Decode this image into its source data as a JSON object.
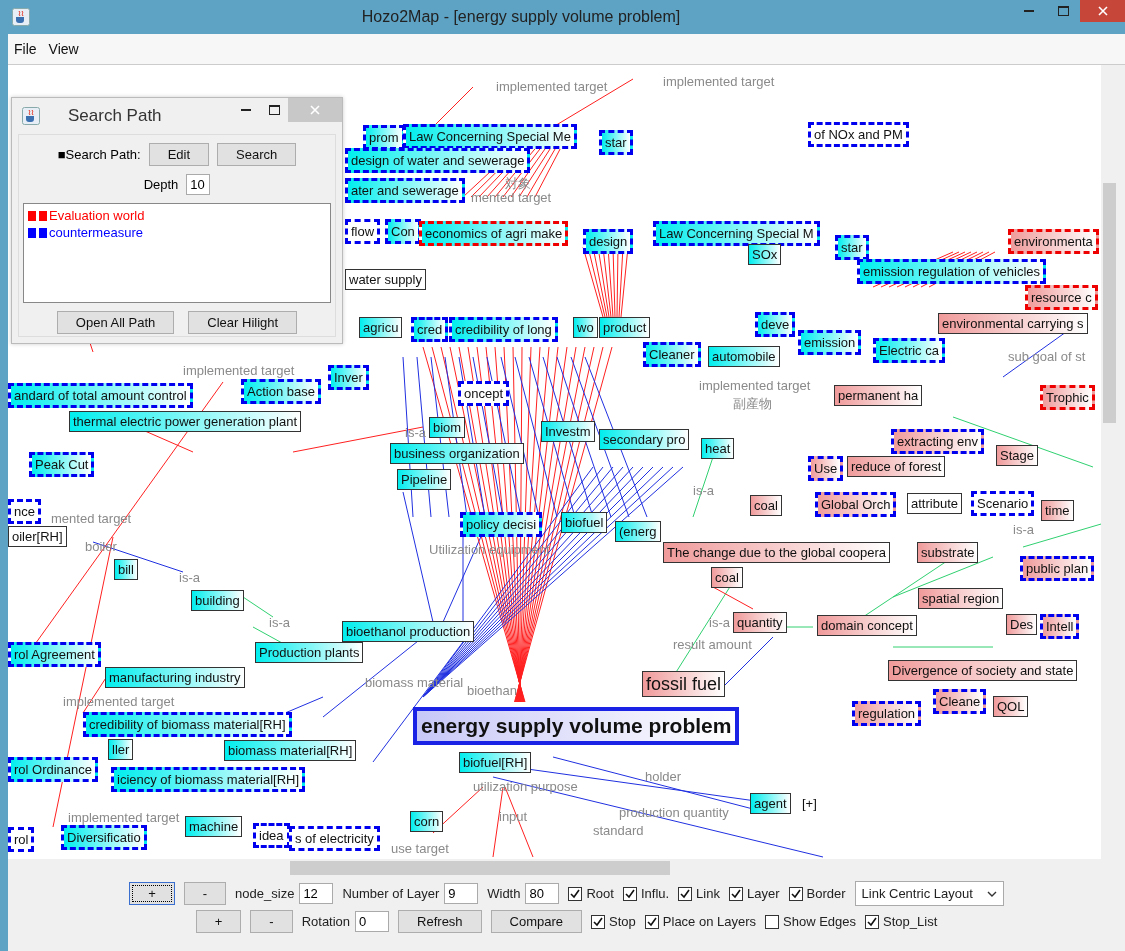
{
  "window": {
    "title": "Hozo2Map - [energy supply volume problem]"
  },
  "menu": [
    "File",
    "View"
  ],
  "graph": {
    "nodes": [
      {
        "text": "prom",
        "kind": "countermeasure",
        "color": "#0000ee"
      },
      {
        "text": "Law Concerning Special Me",
        "kind": "countermeasure",
        "color": "#0000ee"
      },
      {
        "text": "star",
        "kind": "countermeasure",
        "color": "#0000ee"
      },
      {
        "text": "of NOx and PM",
        "kind": "plain",
        "color": "#0000ee"
      },
      {
        "text": "design of water and sewerage",
        "kind": "countermeasure",
        "color": "#0000ee"
      },
      {
        "text": "ater and sewerage",
        "kind": "countermeasure",
        "color": "#0000ee"
      },
      {
        "text": "flow",
        "kind": "plain",
        "color": "#0000ee"
      },
      {
        "text": "Con",
        "kind": "countermeasure",
        "color": "#0000ee"
      },
      {
        "text": "economics of agri make",
        "kind": "countermeasure",
        "color": "#ee0000"
      },
      {
        "text": "design",
        "kind": "countermeasure",
        "color": "#0000ee"
      },
      {
        "text": "Law Concerning Special M",
        "kind": "countermeasure",
        "color": "#0000ee"
      },
      {
        "text": "star",
        "kind": "countermeasure",
        "color": "#0000ee"
      },
      {
        "text": "environmenta",
        "kind": "evaluation",
        "color": "#ee0000"
      },
      {
        "text": "SOx",
        "kind": "countermeasure"
      },
      {
        "text": "water supply",
        "kind": "plain"
      },
      {
        "text": "emission regulation of vehicles",
        "kind": "countermeasure",
        "color": "#0000ee"
      },
      {
        "text": "resource c",
        "kind": "evaluation",
        "color": "#ee0000"
      },
      {
        "text": "agricu",
        "kind": "countermeasure"
      },
      {
        "text": "cred",
        "kind": "countermeasure",
        "color": "#0000ee"
      },
      {
        "text": "credibility of long",
        "kind": "countermeasure",
        "color": "#0000ee"
      },
      {
        "text": "wo",
        "kind": "countermeasure"
      },
      {
        "text": "product",
        "kind": "countermeasure"
      },
      {
        "text": "deve",
        "kind": "countermeasure",
        "color": "#0000ee"
      },
      {
        "text": "Cleaner",
        "kind": "countermeasure",
        "color": "#0000ee"
      },
      {
        "text": "automobile",
        "kind": "countermeasure"
      },
      {
        "text": "emission",
        "kind": "countermeasure",
        "color": "#0000ee"
      },
      {
        "text": "Electric ca",
        "kind": "countermeasure",
        "color": "#0000ee"
      },
      {
        "text": "environmental carrying s",
        "kind": "evaluation"
      },
      {
        "text": "andard of total amount control",
        "kind": "countermeasure",
        "color": "#0000ee"
      },
      {
        "text": "Action base",
        "kind": "countermeasure",
        "color": "#0000ee"
      },
      {
        "text": "Inver",
        "kind": "countermeasure",
        "color": "#0000ee"
      },
      {
        "text": "oncept",
        "kind": "plain",
        "color": "#0000ee"
      },
      {
        "text": "permanent ha",
        "kind": "evaluation"
      },
      {
        "text": "Trophic",
        "kind": "evaluation",
        "color": "#ee0000"
      },
      {
        "text": "thermal electric power generation plant",
        "kind": "countermeasure"
      },
      {
        "text": "biom",
        "kind": "countermeasure"
      },
      {
        "text": "business organization",
        "kind": "countermeasure"
      },
      {
        "text": "Investm",
        "kind": "countermeasure"
      },
      {
        "text": "secondary pro",
        "kind": "countermeasure"
      },
      {
        "text": "heat",
        "kind": "countermeasure"
      },
      {
        "text": "extracting env",
        "kind": "evaluation",
        "color": "#0000ee"
      },
      {
        "text": "Stage",
        "kind": "evaluation"
      },
      {
        "text": "Peak Cut",
        "kind": "countermeasure",
        "color": "#0000ee"
      },
      {
        "text": "Pipeline",
        "kind": "countermeasure"
      },
      {
        "text": "Use",
        "kind": "evaluation",
        "color": "#0000ee"
      },
      {
        "text": "reduce of forest",
        "kind": "evaluation"
      },
      {
        "text": "nce",
        "kind": "plain",
        "color": "#0000ee"
      },
      {
        "text": "oiler[RH]",
        "kind": "plain"
      },
      {
        "text": "policy decisi",
        "kind": "countermeasure",
        "color": "#0000ee"
      },
      {
        "text": "biofuel",
        "kind": "countermeasure"
      },
      {
        "text": "(energ",
        "kind": "countermeasure"
      },
      {
        "text": "coal",
        "kind": "evaluation"
      },
      {
        "text": "Global Orch",
        "kind": "evaluation",
        "color": "#0000ee"
      },
      {
        "text": "attribute",
        "kind": "plain"
      },
      {
        "text": "Scenario",
        "kind": "plain",
        "color": "#0000ee"
      },
      {
        "text": "time",
        "kind": "evaluation"
      },
      {
        "text": "bill",
        "kind": "countermeasure"
      },
      {
        "text": "The change due to the global coopera",
        "kind": "evaluation"
      },
      {
        "text": "substrate",
        "kind": "evaluation"
      },
      {
        "text": "coal",
        "kind": "evaluation"
      },
      {
        "text": "public plan",
        "kind": "evaluation",
        "color": "#0000ee"
      },
      {
        "text": "building",
        "kind": "countermeasure"
      },
      {
        "text": "spatial region",
        "kind": "evaluation"
      },
      {
        "text": "bioethanol production",
        "kind": "countermeasure"
      },
      {
        "text": "quantity",
        "kind": "evaluation"
      },
      {
        "text": "domain concept",
        "kind": "evaluation"
      },
      {
        "text": "Des",
        "kind": "evaluation"
      },
      {
        "text": "Intell",
        "kind": "evaluation",
        "color": "#0000ee"
      },
      {
        "text": "rol Agreement",
        "kind": "countermeasure",
        "color": "#0000ee"
      },
      {
        "text": "Production plants",
        "kind": "countermeasure"
      },
      {
        "text": "manufacturing industry",
        "kind": "countermeasure"
      },
      {
        "text": "Divergence of society and state",
        "kind": "evaluation"
      },
      {
        "text": "fossil fuel",
        "kind": "evaluation"
      },
      {
        "text": "credibility of biomass material[RH]",
        "kind": "countermeasure",
        "color": "#0000ee"
      },
      {
        "text": "energy supply volume problem",
        "kind": "focus"
      },
      {
        "text": "regulation",
        "kind": "evaluation",
        "color": "#0000ee"
      },
      {
        "text": "Cleane",
        "kind": "evaluation",
        "color": "#0000ee"
      },
      {
        "text": "QOL",
        "kind": "evaluation"
      },
      {
        "text": "rol Ordinance",
        "kind": "countermeasure",
        "color": "#0000ee"
      },
      {
        "text": "ller",
        "kind": "countermeasure"
      },
      {
        "text": "iciency of biomass material[RH]",
        "kind": "countermeasure",
        "color": "#0000ee"
      },
      {
        "text": "biomass material[RH]",
        "kind": "countermeasure"
      },
      {
        "text": "biofuel[RH]",
        "kind": "countermeasure"
      },
      {
        "text": "rol",
        "kind": "plain",
        "color": "#0000ee"
      },
      {
        "text": "Diversificatio",
        "kind": "countermeasure",
        "color": "#0000ee"
      },
      {
        "text": "machine",
        "kind": "countermeasure"
      },
      {
        "text": "idea",
        "kind": "plain",
        "color": "#0000ee"
      },
      {
        "text": "s of electricity",
        "kind": "plain",
        "color": "#0000ee"
      },
      {
        "text": "corn",
        "kind": "countermeasure"
      },
      {
        "text": "agent",
        "kind": "countermeasure",
        "suffix": "[+]"
      }
    ],
    "edge_labels": [
      "implemented target",
      "implemented target",
      "対象",
      "mented target",
      "sub goal of st",
      "implemented target",
      "implemented target",
      "副産物",
      "is-a",
      "is-a",
      "mented target",
      "is-a",
      "boiler",
      "Utilization equipment",
      "is-a",
      "is-a",
      "is-a",
      "result amount",
      "biomass material",
      "bioethan",
      "implemented target",
      "holder",
      "utilization purpose",
      "input",
      "production quantity",
      "implemented target",
      "standard",
      "use target"
    ]
  },
  "search_panel": {
    "title": "Search Path",
    "path_label": "■Search Path:",
    "buttons": [
      "Edit",
      "Search"
    ],
    "depth_label": "Depth",
    "depth": "10",
    "paths": [
      {
        "label": "Evaluation world",
        "color": "#ff0000"
      },
      {
        "label": "countermeasure",
        "color": "#0000ff"
      }
    ],
    "footer_buttons": [
      "Open All Path",
      "Clear Hilight"
    ]
  },
  "toolbar": [
    {
      "items": [
        {
          "kind": "button",
          "text": "+",
          "focused": true
        },
        {
          "kind": "button",
          "text": "-",
          "focused": false
        },
        {
          "kind": "field",
          "label": "node_size",
          "value": "12"
        },
        {
          "kind": "field",
          "label": "Number of Layer",
          "value": "9"
        },
        {
          "kind": "field",
          "label": "Width",
          "value": "80"
        },
        {
          "kind": "checkbox",
          "label": "Root",
          "checked": true
        },
        {
          "kind": "checkbox",
          "label": "Influ.",
          "checked": true
        },
        {
          "kind": "checkbox",
          "label": "Link",
          "checked": true
        },
        {
          "kind": "checkbox",
          "label": "Layer",
          "checked": true
        },
        {
          "kind": "checkbox",
          "label": "Border",
          "checked": true
        },
        {
          "kind": "select",
          "value": "Link Centric Layout"
        }
      ]
    },
    {
      "items": [
        {
          "kind": "button",
          "text": "+",
          "focused": false
        },
        {
          "kind": "button",
          "text": "-",
          "focused": false
        },
        {
          "kind": "field",
          "label": "Rotation",
          "value": "0"
        },
        {
          "kind": "button",
          "text": "Refresh",
          "focused": false
        },
        {
          "kind": "button",
          "text": "Compare",
          "focused": false
        },
        {
          "kind": "checkbox",
          "label": "Stop",
          "checked": true
        },
        {
          "kind": "checkbox",
          "label": "Place on Layers",
          "checked": true
        },
        {
          "kind": "checkbox",
          "label": "Show Edges",
          "checked": false
        },
        {
          "kind": "checkbox",
          "label": "Stop_List",
          "checked": true
        }
      ]
    }
  ]
}
